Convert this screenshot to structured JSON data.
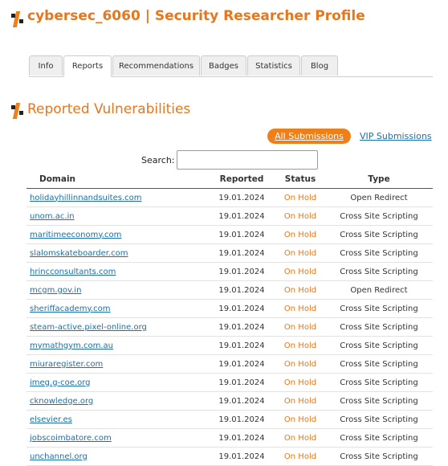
{
  "header": {
    "title": "cybersec_6060 | Security Researcher Profile"
  },
  "tabs": [
    {
      "label": "Info"
    },
    {
      "label": "Reports"
    },
    {
      "label": "Recommendations"
    },
    {
      "label": "Badges"
    },
    {
      "label": "Statistics"
    },
    {
      "label": "Blog"
    }
  ],
  "section": {
    "title": "Reported Vulnerabilities"
  },
  "filters": {
    "all_label": "All Submissions",
    "vip_label": "VIP Submissions"
  },
  "search": {
    "label": "Search:",
    "value": ""
  },
  "table": {
    "columns": [
      "Domain",
      "Reported",
      "Status",
      "Type"
    ],
    "rows": [
      {
        "domain": "holidayhillinnandsuites.com",
        "reported": "19.01.2024",
        "status": "On Hold",
        "type": "Open Redirect"
      },
      {
        "domain": "unom.ac.in",
        "reported": "19.01.2024",
        "status": "On Hold",
        "type": "Cross Site Scripting"
      },
      {
        "domain": "maritimeeconomy.com",
        "reported": "19.01.2024",
        "status": "On Hold",
        "type": "Cross Site Scripting"
      },
      {
        "domain": "slalomskateboarder.com",
        "reported": "19.01.2024",
        "status": "On Hold",
        "type": "Cross Site Scripting"
      },
      {
        "domain": "hrincconsultants.com",
        "reported": "19.01.2024",
        "status": "On Hold",
        "type": "Cross Site Scripting"
      },
      {
        "domain": "mcgm.gov.in",
        "reported": "19.01.2024",
        "status": "On Hold",
        "type": "Open Redirect"
      },
      {
        "domain": "sheriffacademy.com",
        "reported": "19.01.2024",
        "status": "On Hold",
        "type": "Cross Site Scripting"
      },
      {
        "domain": "steam-active.pixel-online.org",
        "reported": "19.01.2024",
        "status": "On Hold",
        "type": "Cross Site Scripting"
      },
      {
        "domain": "mymathgym.com.au",
        "reported": "19.01.2024",
        "status": "On Hold",
        "type": "Cross Site Scripting"
      },
      {
        "domain": "miuraregister.com",
        "reported": "19.01.2024",
        "status": "On Hold",
        "type": "Cross Site Scripting"
      },
      {
        "domain": "imeg.g-coe.org",
        "reported": "19.01.2024",
        "status": "On Hold",
        "type": "Cross Site Scripting"
      },
      {
        "domain": "cknowledge.org",
        "reported": "19.01.2024",
        "status": "On Hold",
        "type": "Cross Site Scripting"
      },
      {
        "domain": "elsevier.es",
        "reported": "19.01.2024",
        "status": "On Hold",
        "type": "Cross Site Scripting"
      },
      {
        "domain": "jobscoimbatore.com",
        "reported": "19.01.2024",
        "status": "On Hold",
        "type": "Cross Site Scripting"
      },
      {
        "domain": "unchannel.org",
        "reported": "19.01.2024",
        "status": "On Hold",
        "type": "Cross Site Scripting"
      }
    ]
  },
  "colors": {
    "accent": "#e8761c",
    "button": "#f07f1a",
    "link": "#1b6fa8"
  },
  "icons": {
    "logo": "openbugbounty-logo-icon"
  }
}
